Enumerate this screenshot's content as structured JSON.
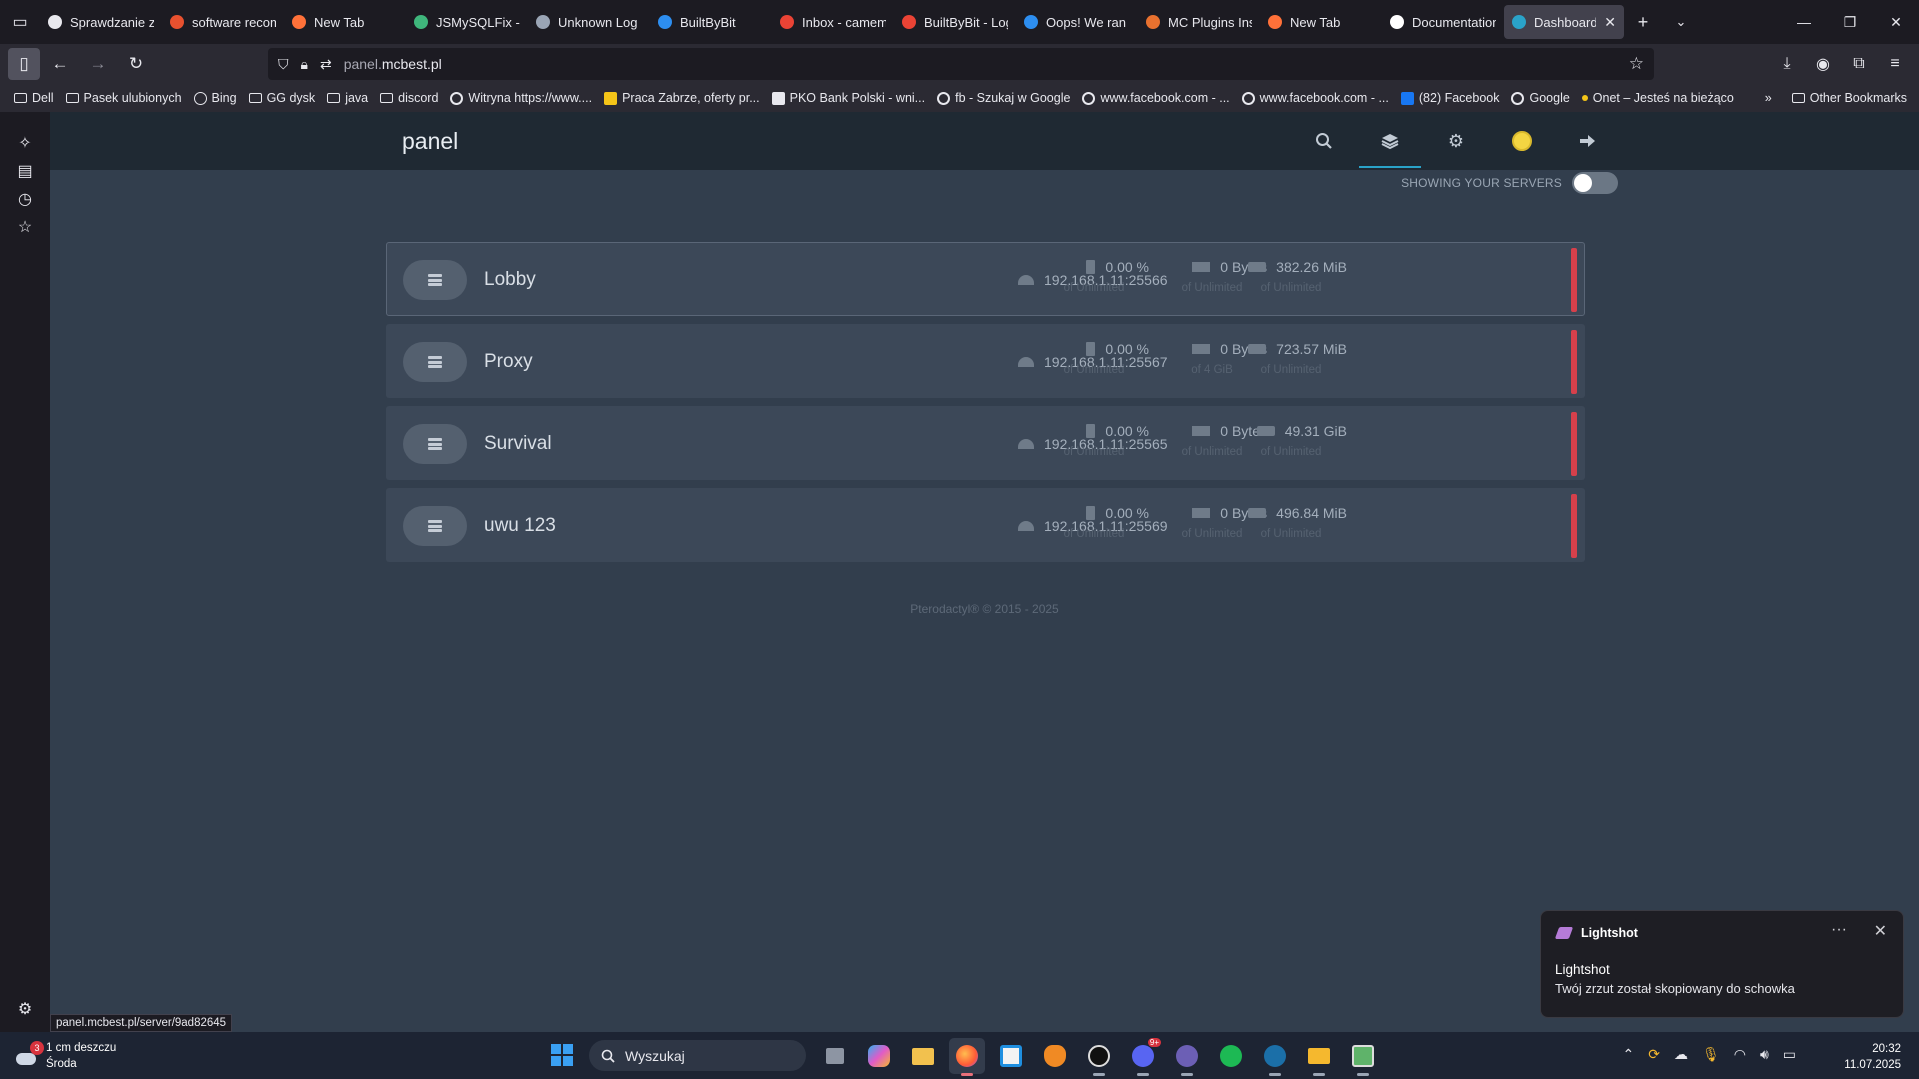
{
  "browser": {
    "tabs": [
      {
        "label": "Sprawdzanie zu",
        "icon": "globe-icon",
        "color": "#e8e8ee"
      },
      {
        "label": "software recom",
        "icon": "ask-icon",
        "color": "#e8512f"
      },
      {
        "label": "New Tab",
        "icon": "firefox-icon",
        "color": "#ff7139"
      },
      {
        "label": "JSMySQLFix - M",
        "icon": "chatgpt-icon",
        "color": "#3fb67c"
      },
      {
        "label": "Unknown Log [",
        "icon": "page-icon",
        "color": "#9aa5b5"
      },
      {
        "label": "BuiltByBit",
        "icon": "builtbybit-icon",
        "color": "#2d8ef0"
      },
      {
        "label": "Inbox - camem",
        "icon": "gmail-icon",
        "color": "#ea4335"
      },
      {
        "label": "BuiltByBit - Log",
        "icon": "gmail-icon",
        "color": "#ea4335"
      },
      {
        "label": "Oops! We ran ir",
        "icon": "builtbybit-icon",
        "color": "#2d8ef0"
      },
      {
        "label": "MC Plugins Inst",
        "icon": "fox-icon",
        "color": "#e8712f"
      },
      {
        "label": "New Tab",
        "icon": "firefox-icon",
        "color": "#ff7139"
      },
      {
        "label": "Documentation",
        "icon": "docs-icon",
        "color": "#ffffff"
      },
      {
        "label": "Dashboard",
        "icon": "pterodactyl-icon",
        "color": "#2aa3c9"
      }
    ],
    "url_host_dim": "panel.",
    "url_host": "mcbest.pl",
    "bookmarks": [
      {
        "label": "Dell",
        "type": "folder"
      },
      {
        "label": "Pasek ulubionych",
        "type": "folder"
      },
      {
        "label": "Bing",
        "type": "globe",
        "color": "#e8e8ee"
      },
      {
        "label": "GG dysk",
        "type": "folder"
      },
      {
        "label": "java",
        "type": "folder"
      },
      {
        "label": "discord",
        "type": "folder"
      },
      {
        "label": "Witryna https://www....",
        "type": "google",
        "color": "#e8e8ee"
      },
      {
        "label": "Praca Zabrze, oferty pr...",
        "type": "site",
        "color": "#f5c518"
      },
      {
        "label": "PKO Bank Polski - wni...",
        "type": "site",
        "color": "#e8e8ee"
      },
      {
        "label": "fb - Szukaj w Google",
        "type": "google",
        "color": "#e8e8ee"
      },
      {
        "label": "www.facebook.com - ...",
        "type": "google",
        "color": "#e8e8ee"
      },
      {
        "label": "www.facebook.com - ...",
        "type": "google",
        "color": "#e8e8ee"
      },
      {
        "label": "(82) Facebook",
        "type": "site",
        "color": "#1877f2"
      },
      {
        "label": "Google",
        "type": "google",
        "color": "#e8e8ee"
      },
      {
        "label": "Onet – Jesteś na bieżąco",
        "type": "dot",
        "color": "#f5c518"
      }
    ],
    "other_bookmarks": "Other Bookmarks",
    "status_url": "panel.mcbest.pl/server/9ad82645"
  },
  "panel": {
    "brand": "panel",
    "toggle_label": "SHOWING YOUR SERVERS",
    "servers": [
      {
        "name": "Lobby",
        "address": "192.168.1.11:25566",
        "cpu": "0.00 %",
        "cpu_limit": "of Unlimited",
        "memory": "0 Bytes",
        "memory_limit": "of Unlimited",
        "disk": "382.26 MiB",
        "disk_limit": "of Unlimited"
      },
      {
        "name": "Proxy",
        "address": "192.168.1.11:25567",
        "cpu": "0.00 %",
        "cpu_limit": "of Unlimited",
        "memory": "0 Bytes",
        "memory_limit": "of 4 GiB",
        "disk": "723.57 MiB",
        "disk_limit": "of Unlimited"
      },
      {
        "name": "Survival",
        "address": "192.168.1.11:25565",
        "cpu": "0.00 %",
        "cpu_limit": "of Unlimited",
        "memory": "0 Bytes",
        "memory_limit": "of Unlimited",
        "disk": "49.31 GiB",
        "disk_limit": "of Unlimited"
      },
      {
        "name": "uwu 123",
        "address": "192.168.1.11:25569",
        "cpu": "0.00 %",
        "cpu_limit": "of Unlimited",
        "memory": "0 Bytes",
        "memory_limit": "of Unlimited",
        "disk": "496.84 MiB",
        "disk_limit": "of Unlimited"
      }
    ],
    "footer": "Pterodactyl® © 2015 - 2025",
    "status_color": "#d6404b"
  },
  "notification": {
    "app": "Lightshot",
    "title": "Lightshot",
    "body": "Twój zrzut został skopiowany do schowka"
  },
  "taskbar": {
    "weather_badge": "3",
    "weather_line1": "1 cm deszczu",
    "weather_line2": "Środa",
    "search_placeholder": "Wyszukaj",
    "discord_badge": "9+",
    "time": "20:32",
    "date": "11.07.2025"
  }
}
